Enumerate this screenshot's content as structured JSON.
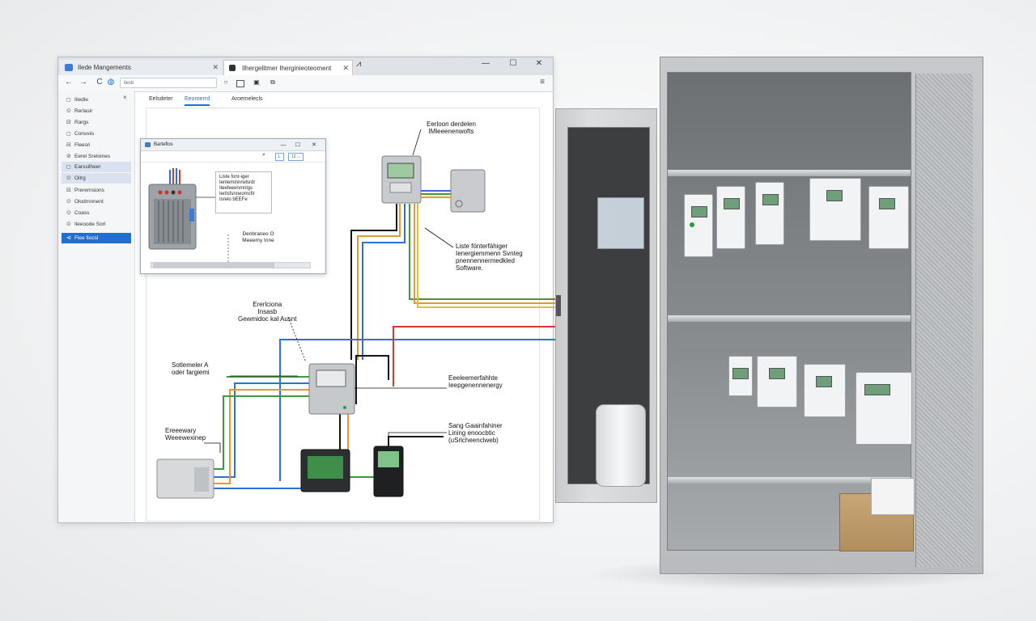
{
  "browser": {
    "tabs": [
      {
        "label": "Ilede Mangements"
      },
      {
        "label": "Ilhergelitmer Iherginieoteoment"
      }
    ],
    "new_tab": "⩘",
    "window_controls": {
      "minimize": "—",
      "maximize": "☐",
      "close": "✕"
    },
    "address": {
      "back": "←",
      "forward": "→",
      "reload": "C",
      "url": "ilesb"
    },
    "menu": "≡"
  },
  "sidebar": {
    "close": "×",
    "items": [
      {
        "label": "Iiledle",
        "icon": "◻"
      },
      {
        "label": "Rerlasir",
        "icon": "⊙"
      },
      {
        "label": "Rargs",
        "icon": "⊟"
      },
      {
        "label": "Conssiis",
        "icon": "◻"
      },
      {
        "label": "Fleesri",
        "icon": "⊟"
      },
      {
        "label": "Eerel Sreloines",
        "icon": "⊘"
      },
      {
        "label": "Earssilheer",
        "icon": "◻"
      },
      {
        "label": "Oilrg",
        "icon": "⊙"
      },
      {
        "label": "Prerernsions",
        "icon": "⊟"
      },
      {
        "label": "Olodrnnnent",
        "icon": "⊙"
      },
      {
        "label": "Coass",
        "icon": "⊙"
      },
      {
        "label": "Ileeoode Sorl",
        "icon": "⊙"
      },
      {
        "label": "Flee fiocsl",
        "icon": "⊲"
      }
    ]
  },
  "content_tabs": [
    "Eelsdeter",
    "Eeoroerrd",
    "Aroemelecls"
  ],
  "inner_window": {
    "title": "Barteflos",
    "chips": [
      "L",
      "12 ..."
    ],
    "note_lines": [
      "Liste fonr-iger",
      "Ienteminnrwlsrdr",
      "Ileefeeenrnnlgs",
      "Ierilsfsnneomcflr",
      "Isrelo bEEFe"
    ],
    "caption_lines": [
      "Denbraneo O",
      "Meeemy Inne"
    ],
    "window_controls": {
      "minimize": "—",
      "maximize": "☐",
      "close": "✕"
    }
  },
  "annotations": {
    "top_right": [
      "Eerloon derdelen",
      "IMleeenenwofts"
    ],
    "right_mid": [
      "Liste fönterfähiger",
      "Ienergiemmenn Svnteg",
      "pnennennermedkled",
      "Software."
    ],
    "center": [
      "Ererlciona",
      "Insasb",
      "Gewmidoc kal Ausnt"
    ],
    "left_mid": [
      "Sotlemeler A",
      "oder fargiemi"
    ],
    "right_lower": [
      "Eeeleemerfahhte",
      "Ieepgenennenergy"
    ],
    "left_lower": [
      "Ereeewary",
      "Weeewexinep"
    ],
    "bottom_right": [
      "Sang Gaainfahiner",
      "Lining enoocbtic",
      "(uSrlcheenclweb)"
    ]
  },
  "colors": {
    "accent": "#1f6fd1",
    "wire_blue": "#2f6fd6",
    "wire_red": "#d43a2a",
    "wire_green": "#3c9a3c",
    "wire_orange": "#e39a2e",
    "wire_black": "#141414",
    "wire_yellow": "#d9c23a"
  }
}
